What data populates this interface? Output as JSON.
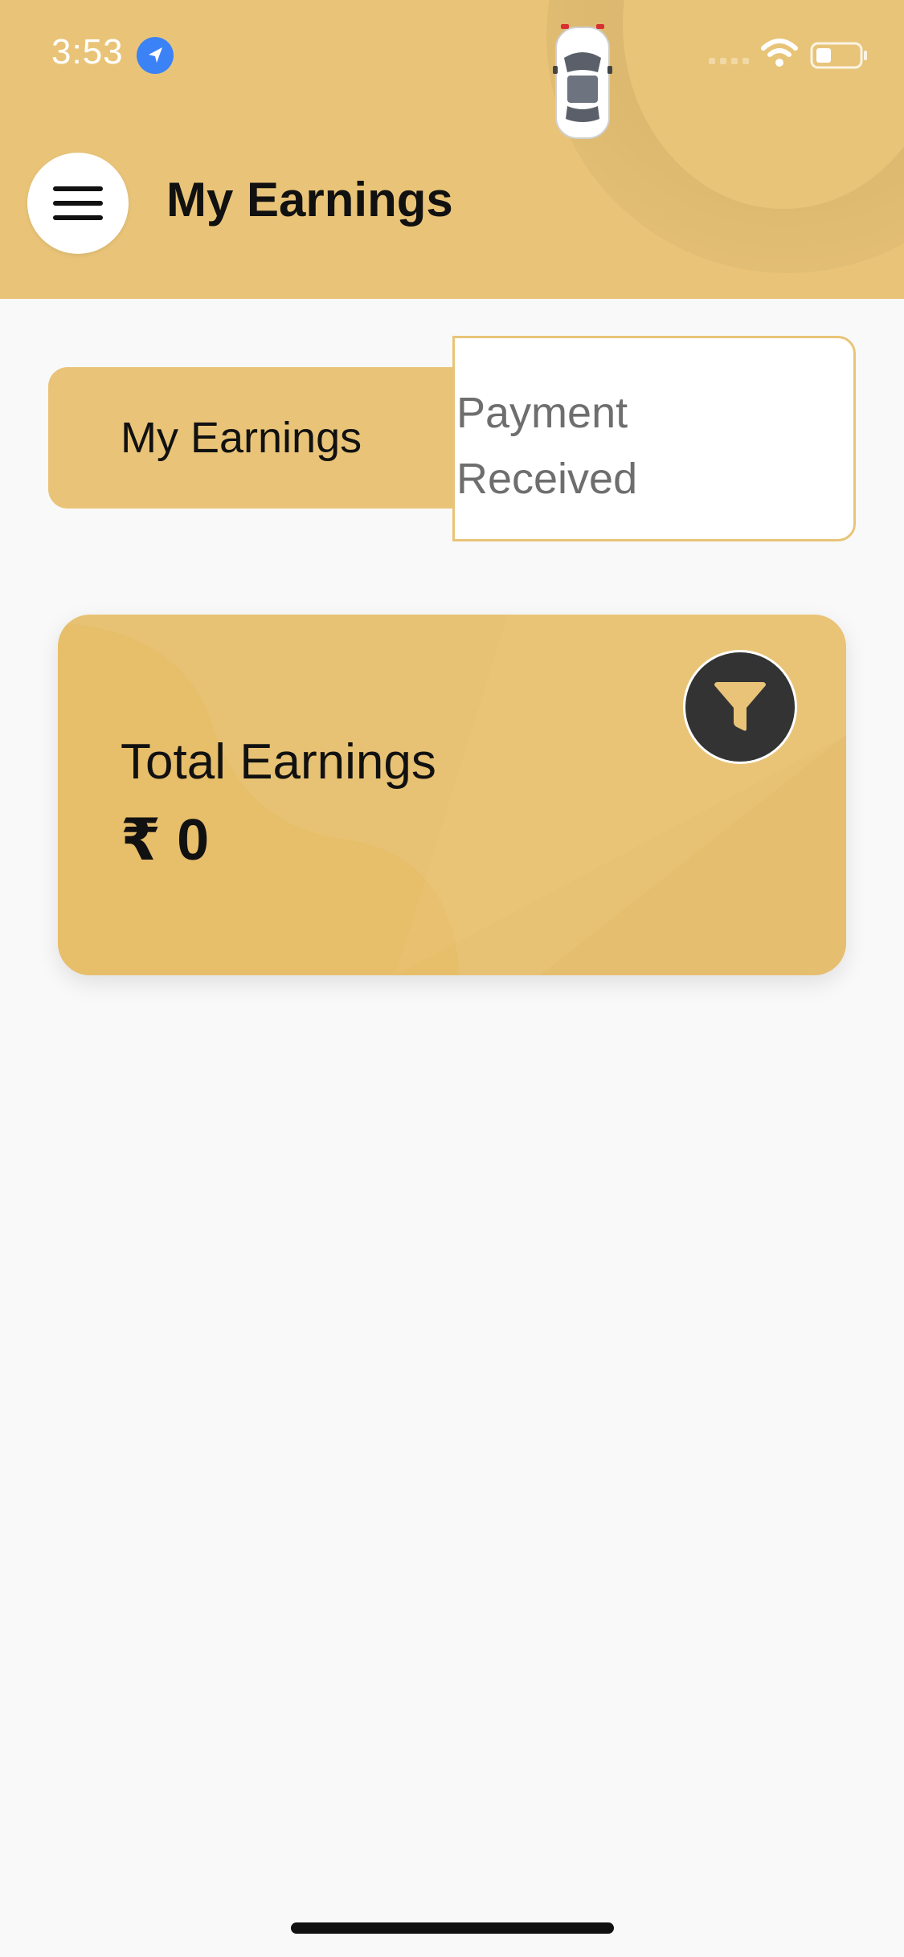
{
  "status_bar": {
    "time": "3:53",
    "icons": [
      "location-arrow-icon",
      "cellular-signal-icon",
      "wifi-icon",
      "battery-icon"
    ]
  },
  "header": {
    "title": "My Earnings",
    "menu_icon": "hamburger-menu-icon",
    "decoration": "car-icon"
  },
  "tabs": [
    {
      "label": "My Earnings",
      "active": true
    },
    {
      "label_lines": [
        "Payment",
        "Received"
      ],
      "active": false
    }
  ],
  "earnings_card": {
    "label": "Total Earnings",
    "value": "₹ 0",
    "filter_icon": "filter-funnel-icon"
  },
  "colors": {
    "accent": "#e9c478",
    "card": "#e8c274",
    "background": "#f9f9f9",
    "dark": "#333333",
    "tab_inactive_text": "#6e6e6e"
  }
}
